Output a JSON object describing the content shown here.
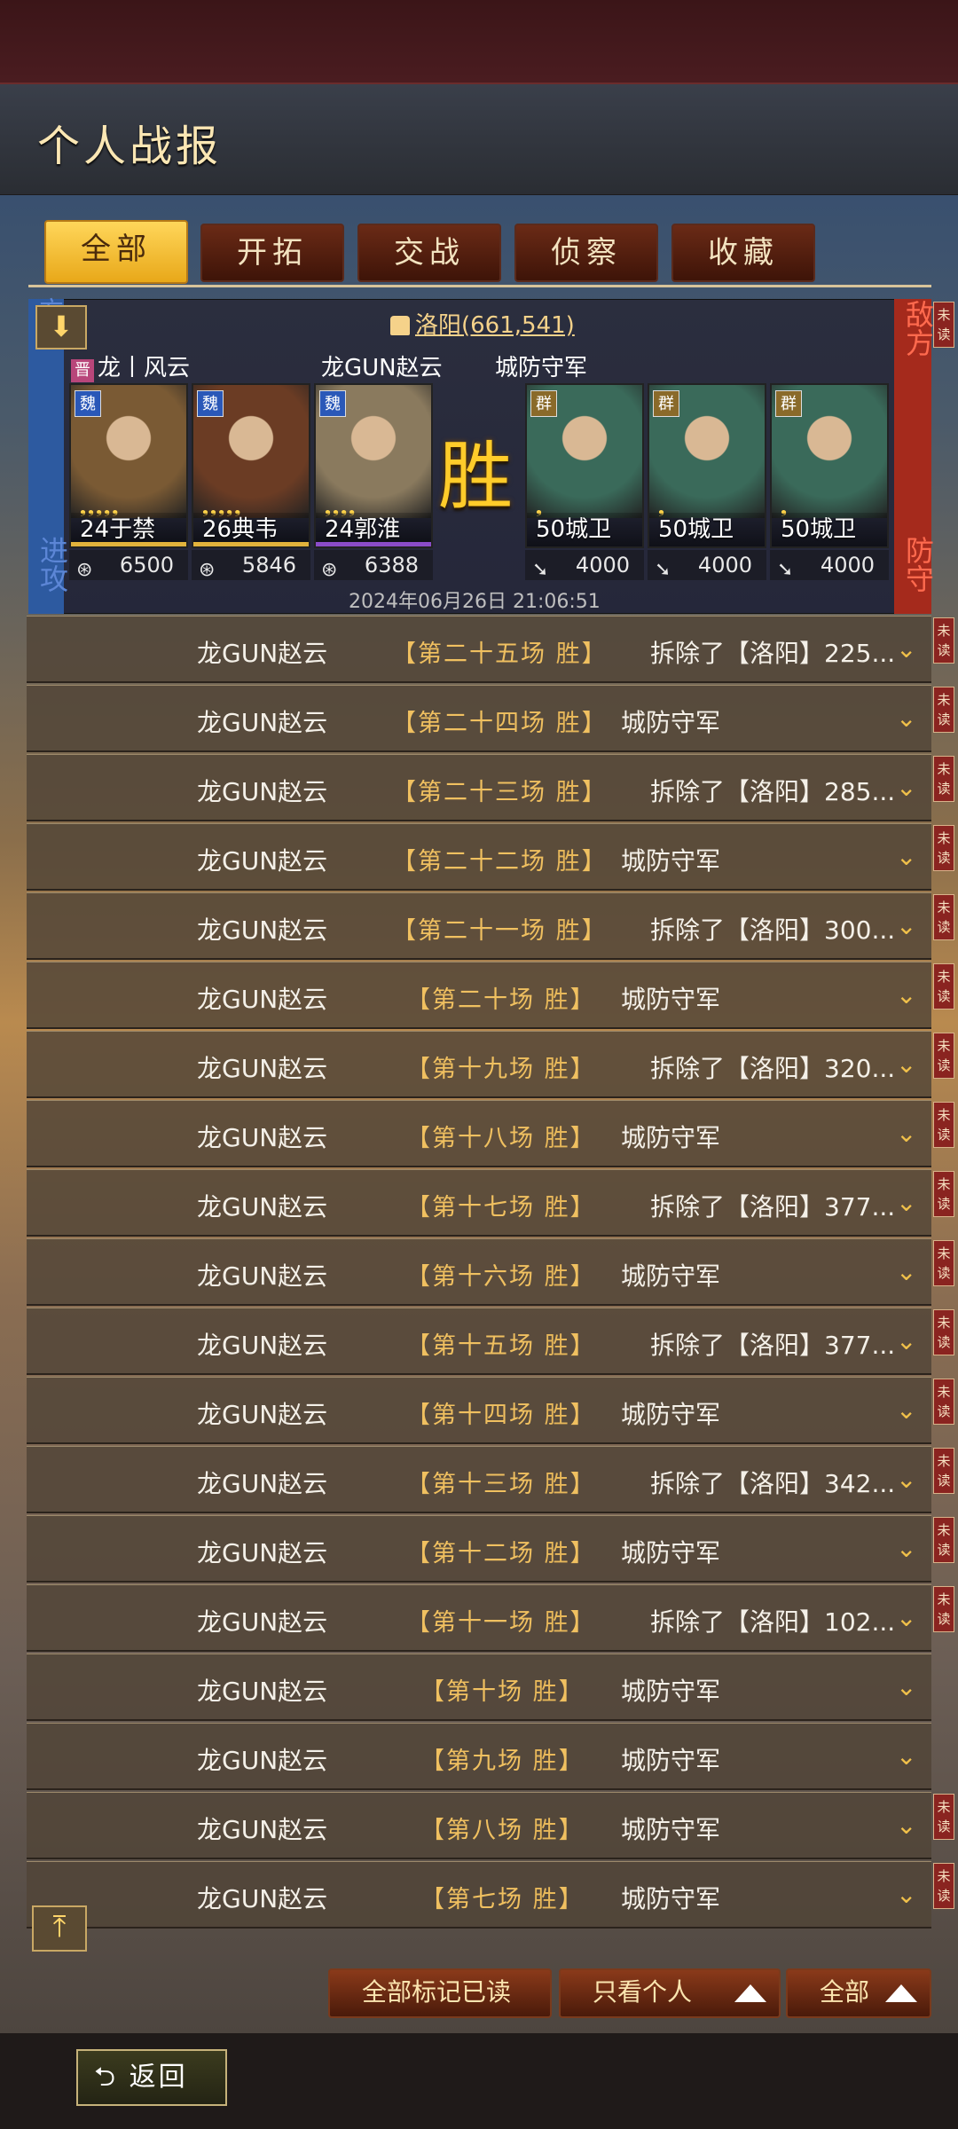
{
  "header": {
    "title": "个人战报"
  },
  "tabs": [
    {
      "label": "全部",
      "active": true
    },
    {
      "label": "开拓",
      "active": false
    },
    {
      "label": "交战",
      "active": false
    },
    {
      "label": "侦察",
      "active": false
    },
    {
      "label": "收藏",
      "active": false
    }
  ],
  "summary": {
    "location": "洛阳(661,541)",
    "left_side": "进攻",
    "left_side_top": "方",
    "right_side_top": "敌方",
    "right_side_bottom": "防守",
    "attacker_tag": "晋",
    "attacker_alliance": "龙丨风云",
    "attacker_name": "龙GUN赵云",
    "defender_name": "城防守军",
    "result": "胜",
    "timestamp": "2024年06月26日 21:06:51",
    "attackers": [
      {
        "faction": "魏",
        "stars": "❟❟❟❟❟",
        "name": "24于禁",
        "troops": "6500",
        "color": "#7a5a34"
      },
      {
        "faction": "魏",
        "stars": "❟❟❟❟❟",
        "name": "26典韦",
        "troops": "5846",
        "color": "#6b3c24"
      },
      {
        "faction": "魏",
        "stars": "❟❟❟❟",
        "name": "24郭淮",
        "troops": "6388",
        "color": "#8a7a5e"
      }
    ],
    "defenders": [
      {
        "faction": "群",
        "stars": "❟",
        "name": "50城卫",
        "troops": "4000",
        "color": "#3a6a5a"
      },
      {
        "faction": "群",
        "stars": "❟",
        "name": "50城卫",
        "troops": "4000",
        "color": "#3a6a5a"
      },
      {
        "faction": "群",
        "stars": "❟",
        "name": "50城卫",
        "troops": "4000",
        "color": "#3a6a5a"
      }
    ]
  },
  "unread_label": "未读",
  "reports": [
    {
      "attacker": "龙GUN赵云",
      "battle": "【第二十五场",
      "win": "胜",
      "close": "】",
      "defender": "拆除了【洛阳】225...",
      "unread": true
    },
    {
      "attacker": "龙GUN赵云",
      "battle": "【第二十四场",
      "win": "胜",
      "close": "】",
      "defender": "城防守军",
      "unread": true
    },
    {
      "attacker": "龙GUN赵云",
      "battle": "【第二十三场",
      "win": "胜",
      "close": "】",
      "defender": "拆除了【洛阳】285...",
      "unread": true
    },
    {
      "attacker": "龙GUN赵云",
      "battle": "【第二十二场",
      "win": "胜",
      "close": "】",
      "defender": "城防守军",
      "unread": true
    },
    {
      "attacker": "龙GUN赵云",
      "battle": "【第二十一场",
      "win": "胜",
      "close": "】",
      "defender": "拆除了【洛阳】300...",
      "unread": true
    },
    {
      "attacker": "龙GUN赵云",
      "battle": "【第二十场",
      "win": "胜",
      "close": "】",
      "defender": "城防守军",
      "unread": true
    },
    {
      "attacker": "龙GUN赵云",
      "battle": "【第十九场",
      "win": "胜",
      "close": "】",
      "defender": "拆除了【洛阳】320...",
      "unread": true
    },
    {
      "attacker": "龙GUN赵云",
      "battle": "【第十八场",
      "win": "胜",
      "close": "】",
      "defender": "城防守军",
      "unread": true
    },
    {
      "attacker": "龙GUN赵云",
      "battle": "【第十七场",
      "win": "胜",
      "close": "】",
      "defender": "拆除了【洛阳】377...",
      "unread": true
    },
    {
      "attacker": "龙GUN赵云",
      "battle": "【第十六场",
      "win": "胜",
      "close": "】",
      "defender": "城防守军",
      "unread": true
    },
    {
      "attacker": "龙GUN赵云",
      "battle": "【第十五场",
      "win": "胜",
      "close": "】",
      "defender": "拆除了【洛阳】377...",
      "unread": true
    },
    {
      "attacker": "龙GUN赵云",
      "battle": "【第十四场",
      "win": "胜",
      "close": "】",
      "defender": "城防守军",
      "unread": true
    },
    {
      "attacker": "龙GUN赵云",
      "battle": "【第十三场",
      "win": "胜",
      "close": "】",
      "defender": "拆除了【洛阳】342...",
      "unread": true
    },
    {
      "attacker": "龙GUN赵云",
      "battle": "【第十二场",
      "win": "胜",
      "close": "】",
      "defender": "城防守军",
      "unread": true
    },
    {
      "attacker": "龙GUN赵云",
      "battle": "【第十一场",
      "win": "胜",
      "close": "】",
      "defender": "拆除了【洛阳】102...",
      "unread": true
    },
    {
      "attacker": "龙GUN赵云",
      "battle": "【第十场",
      "win": "胜",
      "close": "】",
      "defender": "城防守军",
      "unread": false
    },
    {
      "attacker": "龙GUN赵云",
      "battle": "【第九场",
      "win": "胜",
      "close": "】",
      "defender": "城防守军",
      "unread": false
    },
    {
      "attacker": "龙GUN赵云",
      "battle": "【第八场",
      "win": "胜",
      "close": "】",
      "defender": "城防守军",
      "unread": true
    },
    {
      "attacker": "龙GUN赵云",
      "battle": "【第七场",
      "win": "胜",
      "close": "】",
      "defender": "城防守军",
      "unread": true
    }
  ],
  "actions": {
    "mark_all_read": "全部标记已读",
    "filter_personal": "只看个人",
    "filter_all": "全部"
  },
  "footer": {
    "back_label": "返回"
  },
  "colors": {
    "tab_active": "#ffd65a",
    "attack_side": "#2d5aa0",
    "defend_side": "#a52a1c",
    "unread_badge": "#8a2420",
    "victory": "#ffcc2a"
  }
}
